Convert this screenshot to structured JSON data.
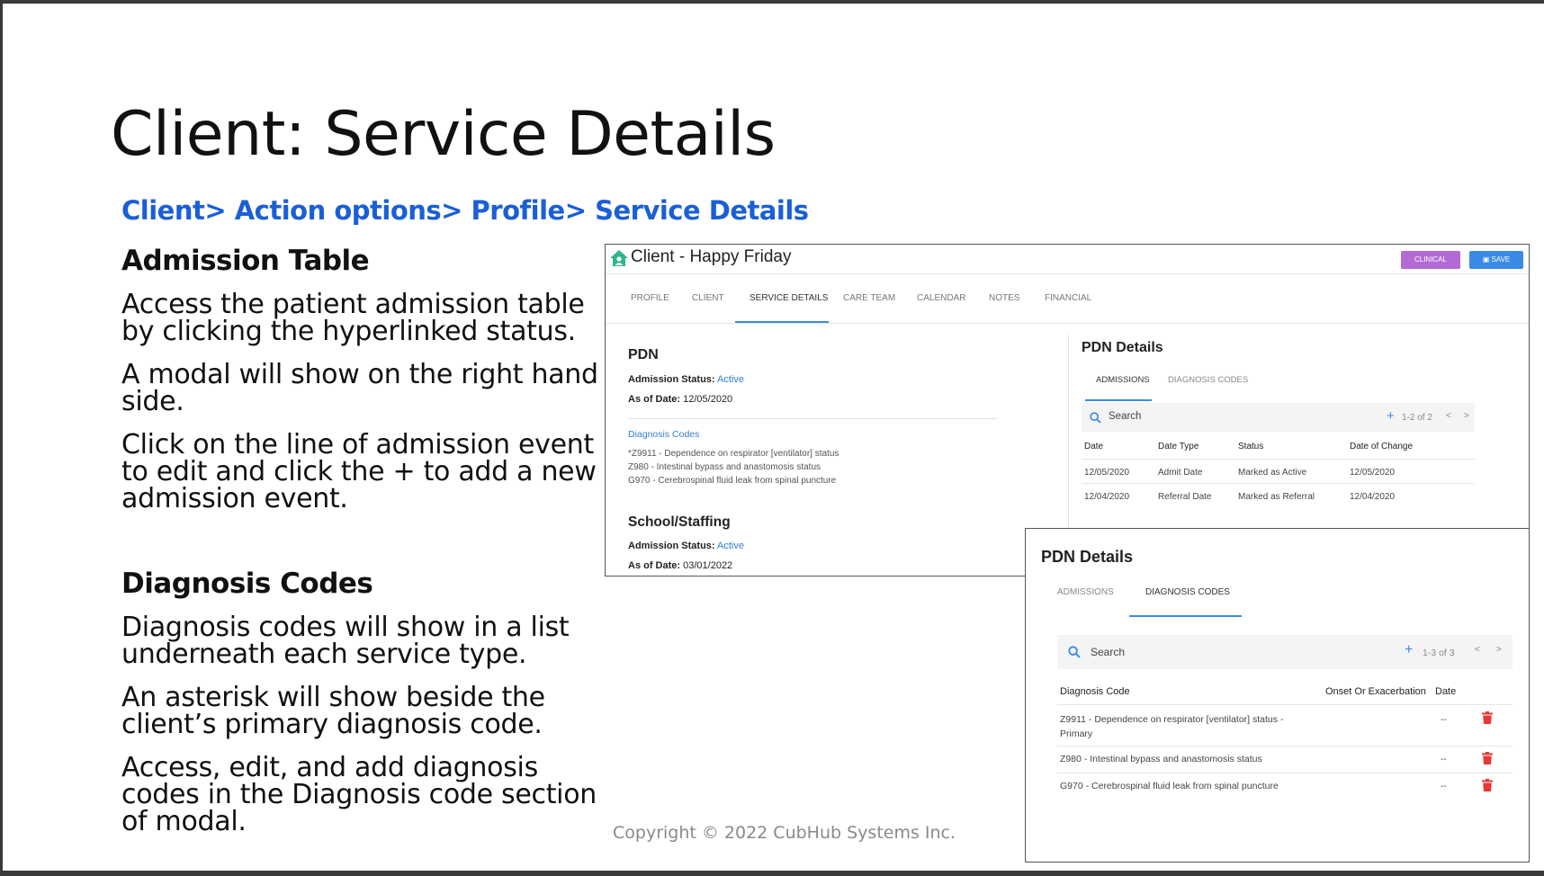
{
  "slide": {
    "title": "Client: Service Details",
    "breadcrumb": "Client> Action options> Profile> Service Details",
    "admission_heading": "Admission Table",
    "admission_p1_line1": "Access the patient admission table",
    "admission_p1_line2": "by clicking the hyperlinked status.",
    "admission_p2_line1": "A modal will show on the right hand",
    "admission_p2_line2": "side.",
    "admission_p3_line1": "Click on the line of admission event",
    "admission_p3_line2": "to edit and click the + to add a new",
    "admission_p3_line3": "admission event.",
    "diagnosis_heading": "Diagnosis Codes",
    "diagnosis_p1_line1": "Diagnosis codes will show in a list",
    "diagnosis_p1_line2": "underneath each service type.",
    "diagnosis_p2_line1": "An asterisk will show beside the",
    "diagnosis_p2_line2": "client’s primary diagnosis code.",
    "diagnosis_p3_line1": "Access, edit, and add diagnosis",
    "diagnosis_p3_line2": "codes in the Diagnosis code section",
    "diagnosis_p3_line3": "of modal.",
    "copyright": "Copyright © 2022 CubHub Systems Inc."
  },
  "app": {
    "title": "Client - Happy Friday",
    "clinical_button": "CLINICAL",
    "save_button": "SAVE",
    "accent": "#3b8ae6",
    "clinical_color": "#b36ad4",
    "tabs": [
      "PROFILE",
      "CLIENT",
      "SERVICE DETAILS",
      "CARE TEAM",
      "CALENDAR",
      "NOTES",
      "FINANCIAL"
    ],
    "active_tab": "SERVICE DETAILS",
    "pdn": {
      "heading": "PDN",
      "status_label": "Admission Status:",
      "status_value": "Active",
      "date_label": "As of Date:",
      "date_value": "12/05/2020",
      "dx_heading": "Diagnosis Codes",
      "dx": [
        "*Z9911 - Dependence on respirator [ventilator] status",
        "Z980 - Intestinal bypass and anastomosis status",
        "G970 - Cerebrospinal fluid leak from spinal puncture"
      ]
    },
    "school": {
      "heading": "School/Staffing",
      "status_label": "Admission Status:",
      "status_value": "Active",
      "date_label": "As of Date:",
      "date_value": "03/01/2022"
    },
    "pdn_details": {
      "title": "PDN Details",
      "tabs": [
        "ADMISSIONS",
        "DIAGNOSIS CODES"
      ],
      "search_placeholder": "Search",
      "pagination": "1-2 of 2",
      "columns": [
        "Date",
        "Date Type",
        "Status",
        "Date of Change"
      ],
      "rows": [
        [
          "12/05/2020",
          "Admit Date",
          "Marked as Active",
          "12/05/2020"
        ],
        [
          "12/04/2020",
          "Referral Date",
          "Marked as Referral",
          "12/04/2020"
        ]
      ]
    }
  },
  "modal": {
    "title": "PDN Details",
    "tabs": [
      "ADMISSIONS",
      "DIAGNOSIS CODES"
    ],
    "active_tab": "DIAGNOSIS CODES",
    "search_placeholder": "Search",
    "pagination": "1-3 of 3",
    "columns": [
      "Diagnosis Code",
      "Onset Or Exacerbation",
      "Date"
    ],
    "rows": [
      {
        "code_line1": "Z9911 - Dependence on respirator [ventilator] status -",
        "code_line2": "Primary",
        "date": "--"
      },
      {
        "code_line1": "Z980 - Intestinal bypass and anastomosis status",
        "code_line2": "",
        "date": "--"
      },
      {
        "code_line1": "G970 - Cerebrospinal fluid leak from spinal puncture",
        "code_line2": "",
        "date": "--"
      }
    ],
    "delete_color": "#e53935"
  }
}
